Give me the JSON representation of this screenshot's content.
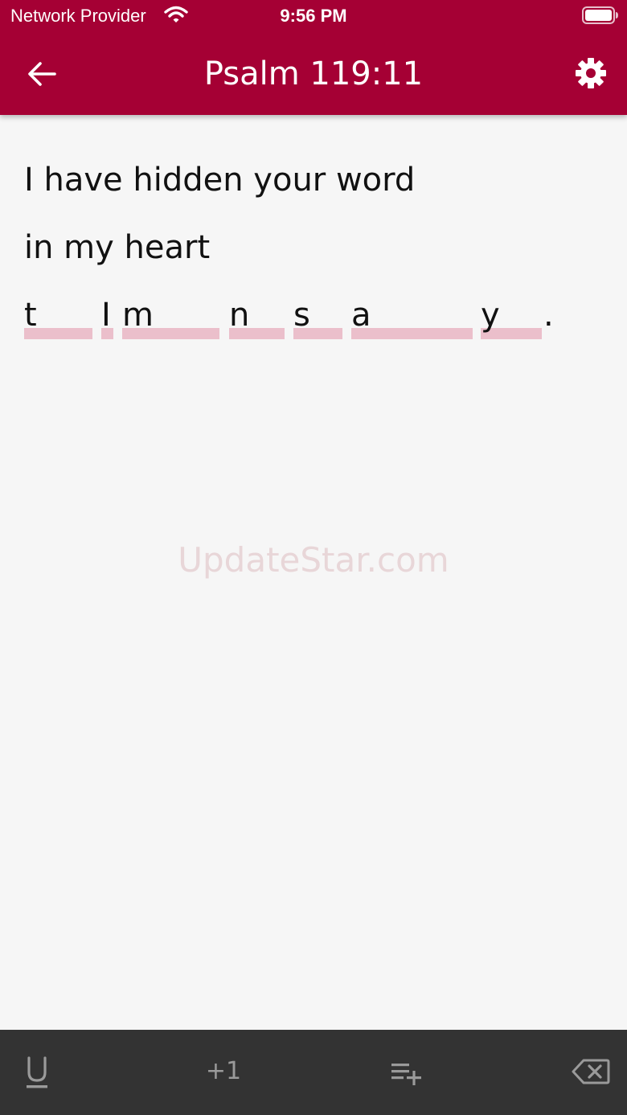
{
  "status_bar": {
    "carrier": "Network Provider",
    "time": "9:56 PM"
  },
  "header": {
    "title": "Psalm 119:11",
    "back_icon": "arrow-left-icon",
    "settings_icon": "gear-icon",
    "background_color": "#a50034"
  },
  "verse": {
    "lines": [
      "I have hidden your word",
      "in my heart"
    ],
    "hint_letters": [
      "t",
      "I",
      "m",
      "n",
      "s",
      "a",
      "y"
    ],
    "ending_punctuation": ".",
    "blank_color": "#ebbfcb"
  },
  "watermark": "UpdateStar.com",
  "toolbar": {
    "background_color": "#333333",
    "underline_icon": "underline-icon",
    "plus_one_label": "+1",
    "add_line_icon": "playlist-add-icon",
    "backspace_icon": "backspace-icon"
  }
}
